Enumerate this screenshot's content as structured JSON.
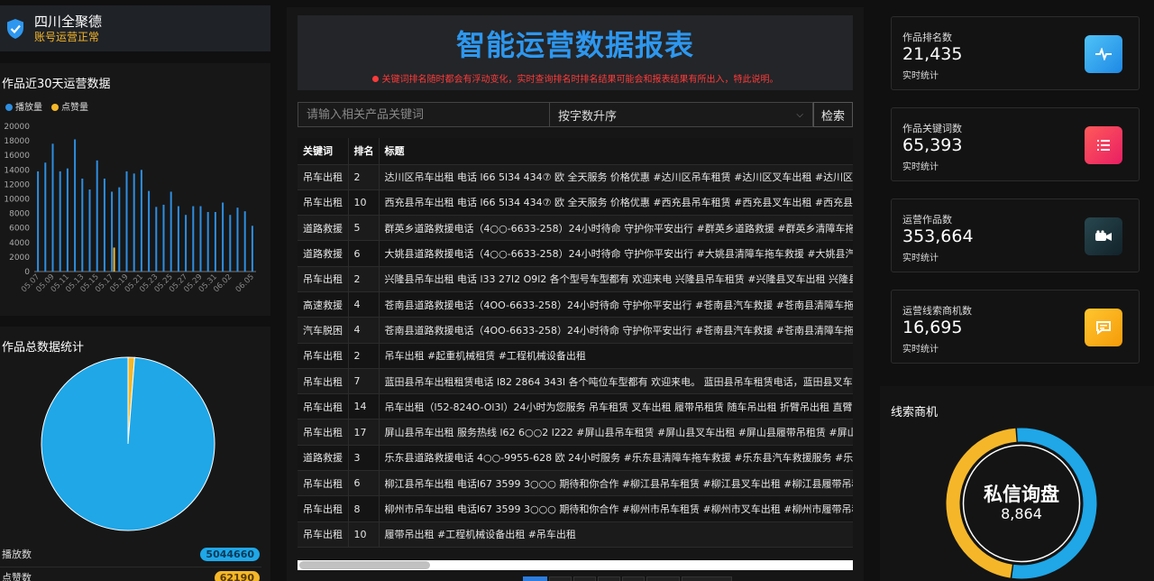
{
  "brand": {
    "name": "四川全聚德",
    "status": "账号运营正常"
  },
  "trend_panel": {
    "title": "作品近30天运营数据"
  },
  "total_panel": {
    "title": "作品总数据统计",
    "rows": [
      {
        "label": "播放数",
        "value": "5044660",
        "color": "#1fa7e8"
      },
      {
        "label": "点赞数",
        "value": "62190",
        "color": "#f5b729"
      }
    ]
  },
  "report": {
    "title": "智能运营数据报表",
    "notice": "关键词排名随时都会有浮动变化，实时查询排名时排名结果可能会和报表结果有所出入，特此说明。"
  },
  "search": {
    "placeholder": "请输入相关产品关键词",
    "sort_value": "按字数升序",
    "button": "检索"
  },
  "table": {
    "headers": [
      "关键词",
      "排名",
      "标题"
    ],
    "rows": [
      [
        "吊车出租",
        "2",
        "达川区吊车出租 电话 l66 5l34 434⑦ 欧 全天服务 价格优惠 #达川区吊车租赁 #达川区叉车出租 #达川区履带吊租赁"
      ],
      [
        "吊车出租",
        "10",
        "西充县吊车出租 电话 l66 5l34 434⑦ 欧 全天服务 价格优惠 #西充县吊车租赁 #西充县叉车出租 #西充县履带吊租赁"
      ],
      [
        "道路救援",
        "5",
        "群英乡道路救援电话（4○○-6633-258）24小时待命 守护你平安出行 #群英乡道路救援 #群英乡清障车拖车救援"
      ],
      [
        "道路救援",
        "6",
        "大姚县道路救援电话（4○○-6633-258）24小时待命 守护你平安出行 #大姚县清障车拖车救援 #大姚县汽车救援"
      ],
      [
        "吊车出租",
        "2",
        "兴隆县吊车出租 电话 l33 27l2 O9l2 各个型号车型都有 欢迎来电 兴隆县吊车租赁 #兴隆县叉车出租 兴隆县履带吊"
      ],
      [
        "高速救援",
        "4",
        "苍南县道路救援电话（4OO-6633-258）24小时待命 守护你平安出行 #苍南县汽车救援 #苍南县清障车拖车救援"
      ],
      [
        "汽车脱困",
        "4",
        "苍南县道路救援电话（4OO-6633-258）24小时待命 守护你平安出行 #苍南县汽车救援 #苍南县清障车拖车救援"
      ],
      [
        "吊车出租",
        "2",
        "吊车出租 #起重机械租赁 #工程机械设备出租"
      ],
      [
        "吊车出租",
        "7",
        "蓝田县吊车出租租赁电话 l82 2864 343l 各个吨位车型都有 欢迎来电。 蓝田县吊车租赁电话，蓝田县叉车出租"
      ],
      [
        "吊车出租",
        "14",
        "吊车出租（l52-824O-Ol3l）24小时为您服务 吊车租赁 叉车出租 履带吊租赁 随车吊出租 折臂吊出租 直臂吊出租"
      ],
      [
        "吊车出租",
        "17",
        "屏山县吊车出租 服务热线 l62 6○○2 l222 #屏山县吊车租赁 #屏山县叉车出租 #屏山县履带吊租赁 #屏山县随车吊"
      ],
      [
        "道路救援",
        "3",
        "乐东县道路救援电话 4○○-9955-628 欧 24小时服务 #乐东县清障车拖车救援 #乐东县汽车救援服务 #乐东县道路救援"
      ],
      [
        "吊车出租",
        "6",
        "柳江县吊车出租 电话l67 3599 3○○○ 期待和你合作 #柳江县吊车租赁 #柳江县叉车出租 #柳江县履带吊租赁"
      ],
      [
        "吊车出租",
        "8",
        "柳州市吊车出租 电话l67 3599 3○○○ 期待和你合作 #柳州市吊车租赁 #柳州市叉车出租 #柳州市履带吊租赁"
      ],
      [
        "吊车出租",
        "10",
        "履带吊出租 #工程机械设备出租 #吊车出租"
      ]
    ]
  },
  "stats": [
    {
      "label": "作品排名数",
      "value": "21,435",
      "sub": "实时统计",
      "icon": "pulse-icon",
      "color": "#2aa8ea"
    },
    {
      "label": "作品关键词数",
      "value": "65,393",
      "sub": "实时统计",
      "icon": "list-icon",
      "color": "#f0365e"
    },
    {
      "label": "运营作品数",
      "value": "353,664",
      "sub": "实时统计",
      "icon": "video-icon",
      "color": "#1c3a46"
    },
    {
      "label": "运营线索商机数",
      "value": "16,695",
      "sub": "实时统计",
      "icon": "chat-icon",
      "color": "#f7b417"
    }
  ],
  "leads_panel": {
    "title": "线索商机",
    "center_label": "私信询盘",
    "center_value": "8,864",
    "share_blue": 0.53,
    "colors": [
      "#1fa7e8",
      "#f5b729"
    ]
  },
  "chart_data": [
    {
      "type": "bar",
      "title": "作品近30天运营数据",
      "categories": [
        "05.07",
        "05.08",
        "05.09",
        "05.10",
        "05.11",
        "05.12",
        "05.13",
        "05.14",
        "05.15",
        "05.16",
        "05.17",
        "05.18",
        "05.19",
        "05.20",
        "05.21",
        "05.22",
        "05.23",
        "05.24",
        "05.25",
        "05.26",
        "05.27",
        "05.28",
        "05.29",
        "05.30",
        "05.31",
        "06.01",
        "06.02",
        "06.03",
        "06.04",
        "06.05"
      ],
      "tick_labels": [
        "05.07",
        "05.09",
        "05.11",
        "05.13",
        "05.15",
        "05.17",
        "05.19",
        "05.21",
        "05.23",
        "05.25",
        "05.27",
        "05.29",
        "05.31",
        "06.02",
        "06.05"
      ],
      "series": [
        {
          "name": "播放量",
          "color": "#2e8ee0",
          "values": [
            13800,
            15000,
            17600,
            13800,
            14200,
            18200,
            12800,
            11300,
            15300,
            12800,
            11000,
            11600,
            13800,
            13500,
            14000,
            11100,
            8900,
            9200,
            11000,
            9000,
            7800,
            9000,
            9000,
            8200,
            8200,
            9500,
            7800,
            8800,
            8300,
            6300
          ]
        },
        {
          "name": "点赞量",
          "color": "#f5b729",
          "values": [
            0,
            0,
            0,
            0,
            0,
            0,
            0,
            0,
            0,
            0,
            3300,
            0,
            0,
            0,
            0,
            0,
            0,
            0,
            0,
            0,
            0,
            0,
            0,
            0,
            0,
            0,
            0,
            0,
            0,
            0
          ]
        }
      ],
      "ylim": [
        0,
        20000
      ],
      "yticks": [
        0,
        2000,
        4000,
        6000,
        8000,
        10000,
        12000,
        14000,
        16000,
        18000,
        20000
      ],
      "legend": "top-left"
    },
    {
      "type": "pie",
      "title": "作品总数据统计",
      "categories": [
        "播放数",
        "点赞数"
      ],
      "values": [
        5044660,
        62190
      ],
      "colors": [
        "#1fa7e8",
        "#f5b729"
      ]
    }
  ]
}
